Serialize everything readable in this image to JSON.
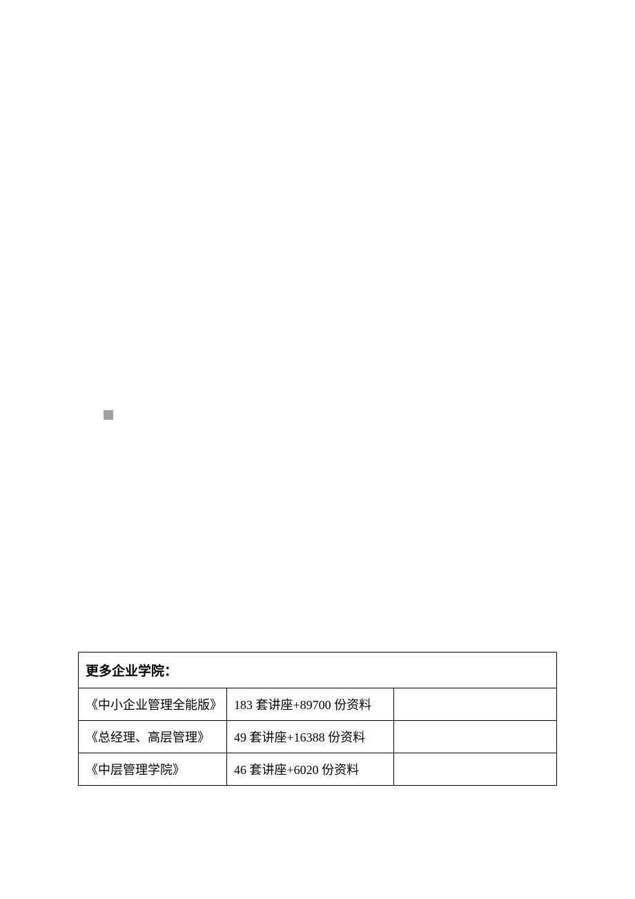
{
  "table": {
    "header": "更多企业学院：",
    "rows": [
      {
        "name": "《中小企业管理全能版》",
        "detail": "183 套讲座+89700 份资料"
      },
      {
        "name": "《总经理、高层管理》",
        "detail": "49 套讲座+16388 份资料"
      },
      {
        "name": "《中层管理学院》",
        "detail": "46 套讲座+6020 份资料"
      }
    ]
  }
}
